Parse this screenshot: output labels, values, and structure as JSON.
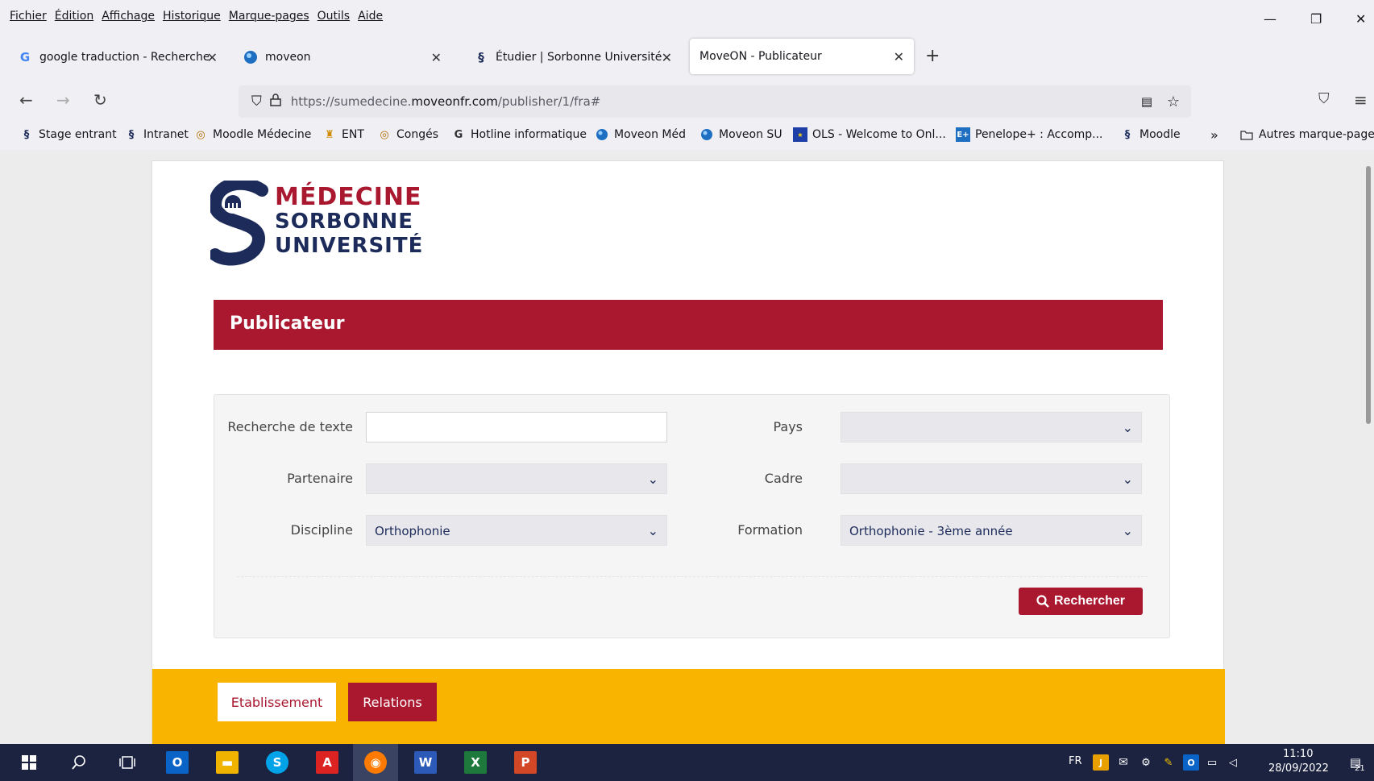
{
  "menubar": {
    "items": [
      "Fichier",
      "Édition",
      "Affichage",
      "Historique",
      "Marque-pages",
      "Outils",
      "Aide"
    ],
    "minimize": "—",
    "restore": "❐",
    "close": "✕"
  },
  "tabs": [
    {
      "label": "google traduction - Recherche Goo",
      "icon": "google-icon",
      "close": "✕"
    },
    {
      "label": "moveon",
      "icon": "moveon-icon",
      "close": "✕"
    },
    {
      "label": "Étudier | Sorbonne Université",
      "icon": "sorbonne-icon",
      "close": "✕"
    },
    {
      "label": "MoveON - Publicateur",
      "icon": "",
      "close": "✕"
    }
  ],
  "new_tab": "+",
  "url": {
    "prefix": "https://sumedecine.",
    "domain": "moveonfr.com",
    "path": "/publisher/1/fra#"
  },
  "bookmarks": [
    {
      "label": "Stage entrant",
      "icon": "sorbonne-icon"
    },
    {
      "label": "Intranet",
      "icon": "sorbonne-icon"
    },
    {
      "label": "Moodle Médecine",
      "icon": "moodle-icon"
    },
    {
      "label": "ENT",
      "icon": "ent-icon"
    },
    {
      "label": "Congés",
      "icon": "moodle-icon"
    },
    {
      "label": "Hotline informatique",
      "icon": "hotline-icon"
    },
    {
      "label": "Moveon Méd",
      "icon": "moveon-icon"
    },
    {
      "label": "Moveon SU",
      "icon": "moveon-icon"
    },
    {
      "label": "OLS - Welcome to Onl...",
      "icon": "eu-flag-icon"
    },
    {
      "label": "Penelope+ : Accomp...",
      "icon": "penelope-icon"
    },
    {
      "label": "Moodle",
      "icon": "sorbonne-icon"
    }
  ],
  "bookmarks_overflow": "»",
  "other_bookmarks": "Autres marque-pages",
  "logo": {
    "line1": "MÉDECINE",
    "line2": "SORBONNE",
    "line3": "UNIVERSITÉ"
  },
  "publisher_title": "Publicateur",
  "filters": {
    "text_search_label": "Recherche de texte",
    "text_search_value": "",
    "country_label": "Pays",
    "country_value": "",
    "partner_label": "Partenaire",
    "partner_value": "",
    "framework_label": "Cadre",
    "framework_value": "",
    "discipline_label": "Discipline",
    "discipline_value": "Orthophonie",
    "training_label": "Formation",
    "training_value": "Orthophonie - 3ème année",
    "search_button": "Rechercher"
  },
  "result_tabs": {
    "tab1": "Etablissement",
    "tab2": "Relations"
  },
  "taskbar": {
    "lang": "FR",
    "time": "11:10",
    "date": "28/09/2022",
    "notif_count": "21"
  },
  "colors": {
    "brand_red": "#aa1830",
    "brand_navy": "#1c2b5a",
    "yellow": "#f9b400"
  }
}
